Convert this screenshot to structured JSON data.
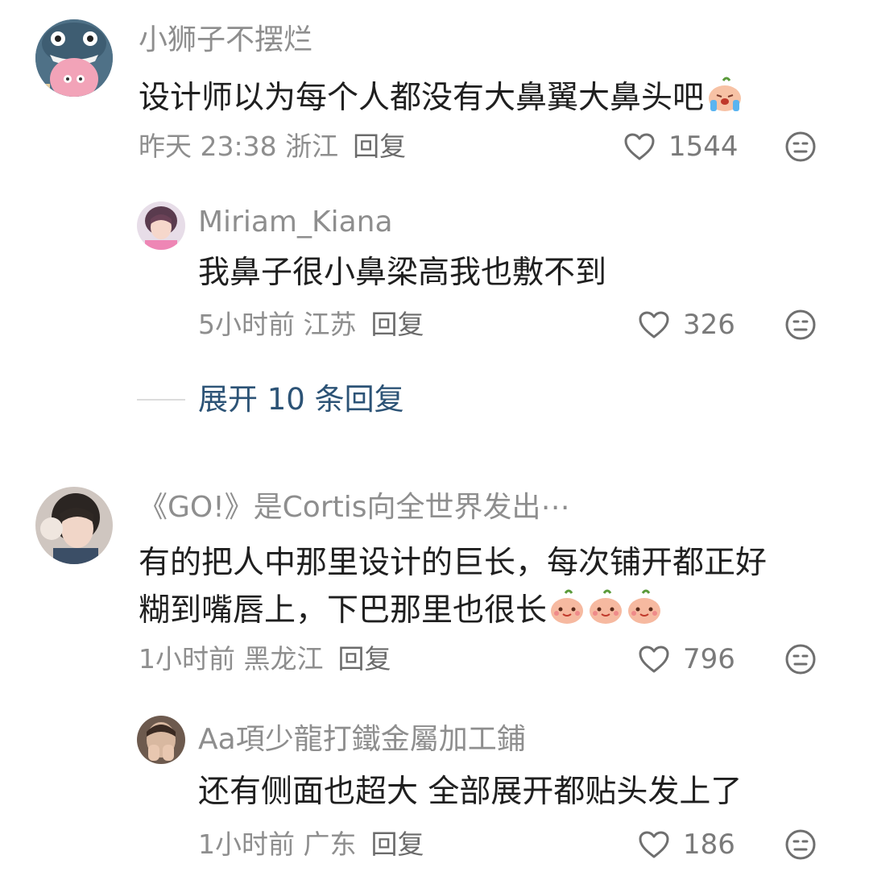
{
  "comments": [
    {
      "username": "小狮子不摆烂",
      "text": "设计师以为每个人都没有大鼻翼大鼻头吧",
      "time_location": "昨天 23:38 浙江",
      "reply_label": "回复",
      "likes": "1544",
      "emoji_count": 1,
      "replies": [
        {
          "username": "Miriam_Kiana",
          "text": "我鼻子很小鼻梁高我也敷不到",
          "time_location": "5小时前 江苏",
          "reply_label": "回复",
          "likes": "326"
        }
      ],
      "expand_label": "展开 10 条回复"
    },
    {
      "username": "《GO!》是Cortis向全世界发出⋯",
      "text_line1": "有的把人中那里设计的巨长，每次铺开都正好",
      "text_line2": "糊到嘴唇上，下巴那里也很长",
      "time_location": "1小时前 黑龙江",
      "reply_label": "回复",
      "likes": "796",
      "emoji_count": 3,
      "replies": [
        {
          "username": "Aa項少龍打鐵金屬加工鋪",
          "text": "还有侧面也超大 全部展开都贴头发上了",
          "time_location": "1小时前 广东",
          "reply_label": "回复",
          "likes": "186"
        }
      ]
    }
  ],
  "icons": {
    "like": "heart-outline-icon",
    "dislike": "meh-face-icon",
    "emoji_crying": "crying-bun-emoji",
    "emoji_smile": "smiling-bun-emoji"
  },
  "colors": {
    "username": "#8e8e8e",
    "text": "#1f1f1f",
    "expand": "#2c5376"
  }
}
